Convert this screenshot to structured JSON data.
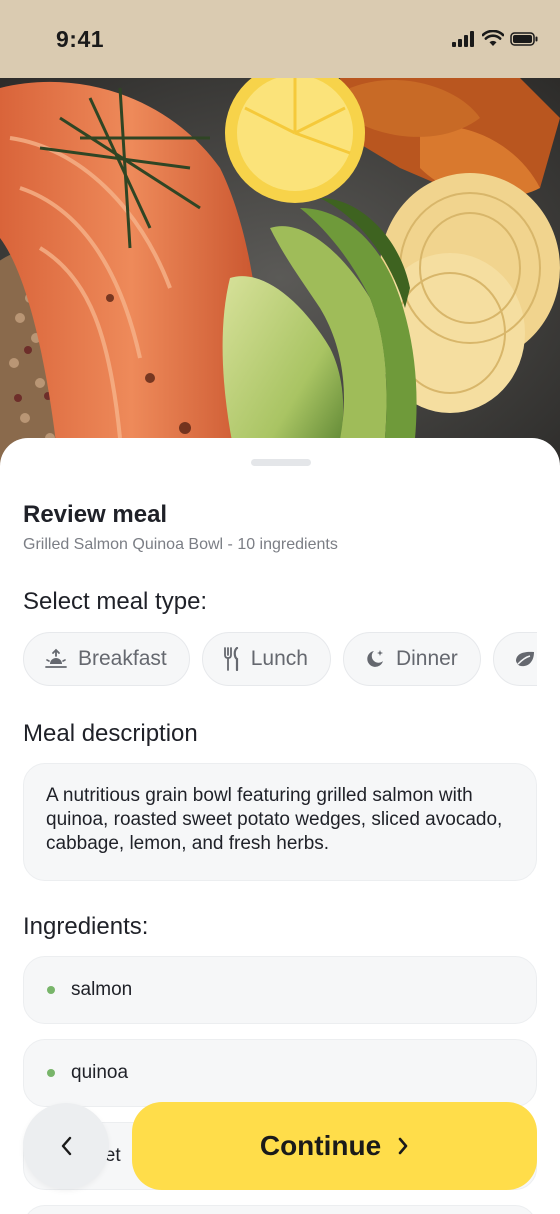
{
  "status_bar": {
    "time": "9:41"
  },
  "sheet": {
    "title": "Review meal",
    "subtitle": "Grilled Salmon Quinoa Bowl - 10 ingredients"
  },
  "meal_type": {
    "heading": "Select meal type:",
    "options": [
      {
        "label": "Breakfast",
        "icon": "sunrise-icon"
      },
      {
        "label": "Lunch",
        "icon": "fork-knife-icon"
      },
      {
        "label": "Dinner",
        "icon": "moon-star-icon"
      },
      {
        "label": "",
        "icon": "leaf-icon"
      }
    ]
  },
  "description": {
    "heading": "Meal description",
    "text": "A nutritious grain bowl featuring grilled salmon with quinoa, roasted sweet potato wedges, sliced avocado, cabbage, lemon, and fresh herbs."
  },
  "ingredients": {
    "heading": "Ingredients:",
    "items": [
      "salmon",
      "quinoa",
      "sweet"
    ]
  },
  "actions": {
    "continue_label": "Continue"
  },
  "colors": {
    "status_bar_bg": "#dacbb1",
    "accent_yellow": "#ffdd4a",
    "ingredient_dot": "#78b56a"
  }
}
